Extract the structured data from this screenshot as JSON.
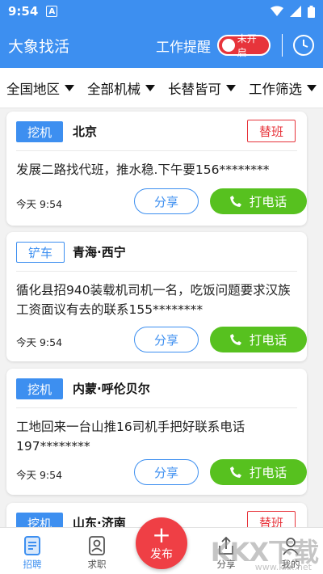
{
  "status": {
    "time": "9:54",
    "badge": "A"
  },
  "header": {
    "title": "大象找活",
    "remind_label": "工作提醒",
    "toggle_label": "未开启"
  },
  "filters": [
    "全国地区",
    "全部机械",
    "长替皆可",
    "工作筛选"
  ],
  "cards": [
    {
      "tag": "挖机",
      "tag_style": "filled",
      "location": "北京",
      "badge": "替班",
      "desc": "发展二路找代班，推水稳.下午要156********",
      "time": "今天 9:54",
      "share": "分享",
      "call": "打电话"
    },
    {
      "tag": "铲车",
      "tag_style": "outline",
      "location": "青海·西宁",
      "badge": "",
      "desc": "循化县招940装载机司机一名，吃饭问题要求汉族工资面议有去的联系155********",
      "time": "今天 9:54",
      "share": "分享",
      "call": "打电话"
    },
    {
      "tag": "挖机",
      "tag_style": "filled",
      "location": "内蒙·呼伦贝尔",
      "badge": "",
      "desc": "工地回来一台山推16司机手把好联系电话197********",
      "time": "今天 9:54",
      "share": "分享",
      "call": "打电话"
    },
    {
      "tag": "挖机",
      "tag_style": "filled",
      "location": "山东·济南",
      "badge": "替班",
      "desc": "",
      "time": "",
      "share": "",
      "call": ""
    }
  ],
  "tabbar": {
    "items": [
      "招聘",
      "求职",
      "分享",
      "我的"
    ],
    "fab_label": "发布",
    "fab_symbol": "+"
  },
  "watermark": {
    "text": "KKX下载",
    "sub": "www.kkx.net"
  },
  "colors": {
    "primary": "#3d8ff0",
    "call_green": "#57c11f",
    "alert_red": "#e7343b"
  }
}
